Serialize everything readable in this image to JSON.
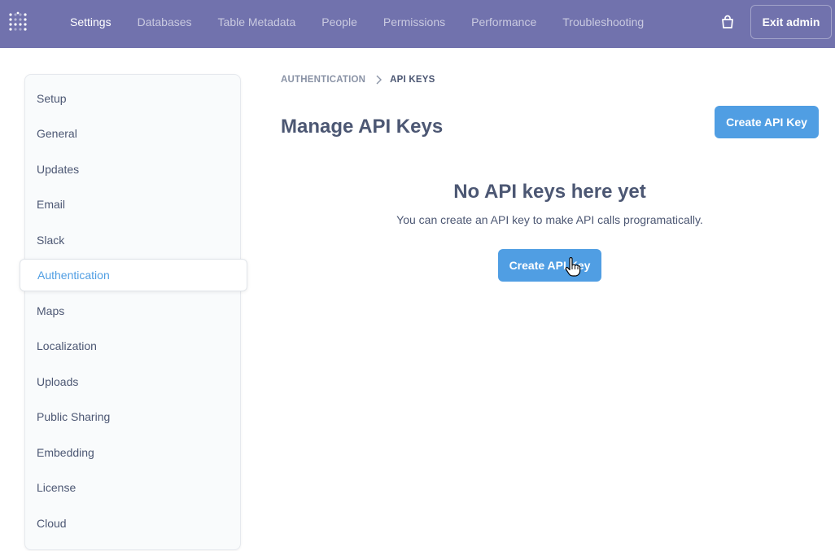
{
  "header": {
    "nav": [
      "Settings",
      "Databases",
      "Table Metadata",
      "People",
      "Permissions",
      "Performance",
      "Troubleshooting"
    ],
    "active_nav": "Settings",
    "exit_label": "Exit admin"
  },
  "sidebar": {
    "items": [
      {
        "label": "Setup"
      },
      {
        "label": "General"
      },
      {
        "label": "Updates"
      },
      {
        "label": "Email"
      },
      {
        "label": "Slack"
      },
      {
        "label": "Authentication"
      },
      {
        "label": "Maps"
      },
      {
        "label": "Localization"
      },
      {
        "label": "Uploads"
      },
      {
        "label": "Public Sharing"
      },
      {
        "label": "Embedding"
      },
      {
        "label": "License"
      },
      {
        "label": "Cloud"
      }
    ],
    "active": "Authentication"
  },
  "breadcrumb": {
    "parent": "AUTHENTICATION",
    "current": "API KEYS"
  },
  "main": {
    "title": "Manage API Keys",
    "create_button_label": "Create API Key",
    "empty_title": "No API keys here yet",
    "empty_description": "You can create an API key to make API calls programatically.",
    "empty_button_label": "Create API Key"
  },
  "colors": {
    "header_bg": "#7172ad",
    "brand": "#509ee3",
    "text": "#4c5773"
  }
}
